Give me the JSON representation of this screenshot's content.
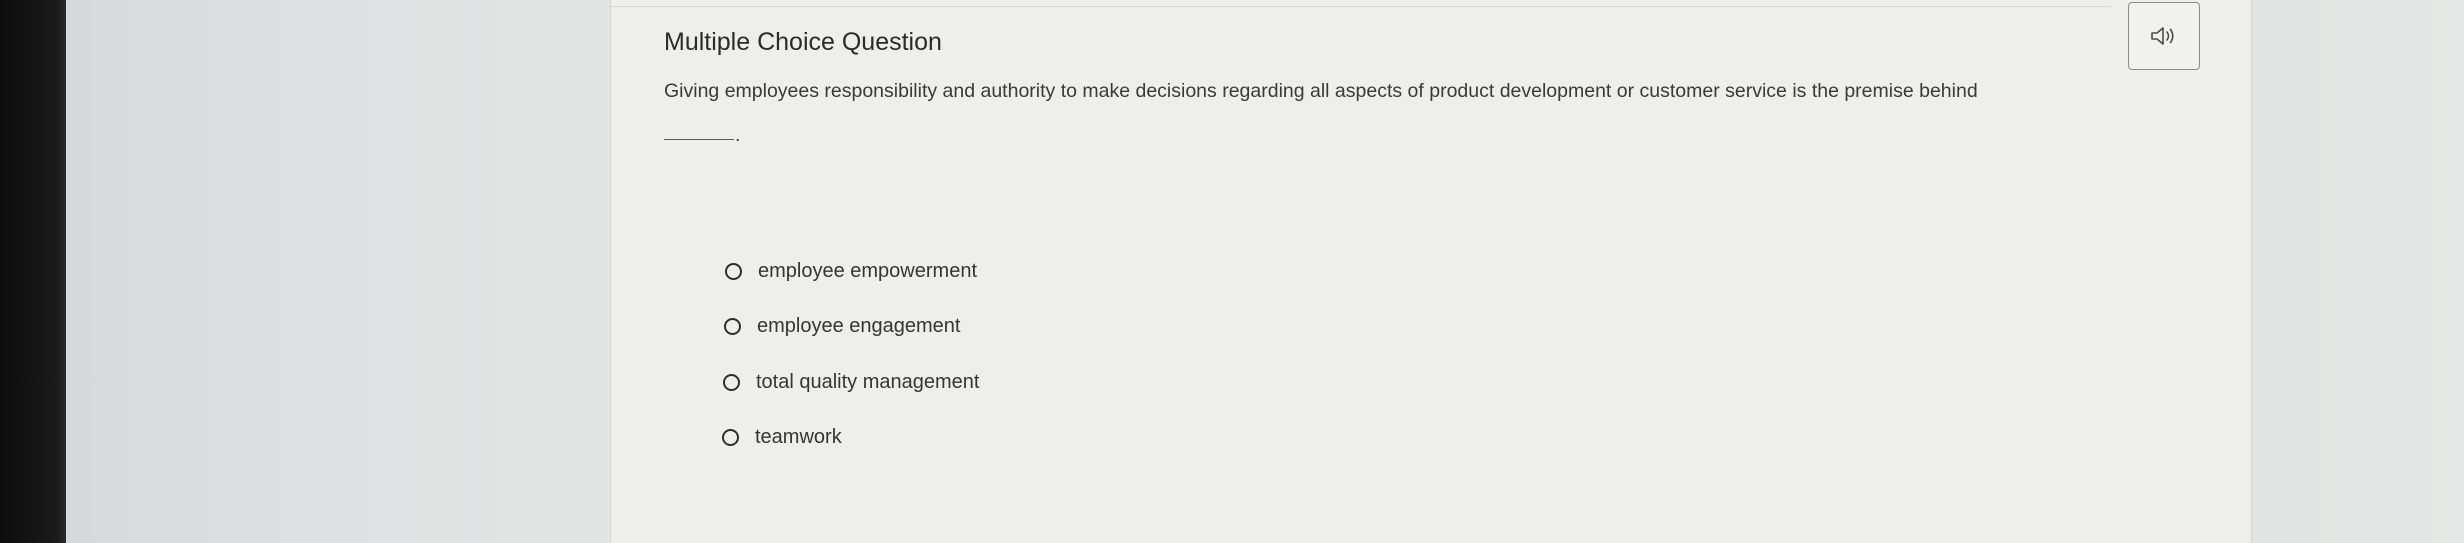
{
  "question": {
    "title": "Multiple Choice Question",
    "audio_icon": "speaker-icon",
    "prompt": "Giving employees responsibility and authority to make decisions regarding all aspects of product development or customer service is the premise behind",
    "blank_suffix": "."
  },
  "options": [
    {
      "label": "employee empowerment"
    },
    {
      "label": "employee engagement"
    },
    {
      "label": "total quality management"
    },
    {
      "label": "teamwork"
    }
  ],
  "colors": {
    "panel_background": "#eeeeed",
    "page_background": "#dfe1e1",
    "text": "#2b2b2b"
  }
}
